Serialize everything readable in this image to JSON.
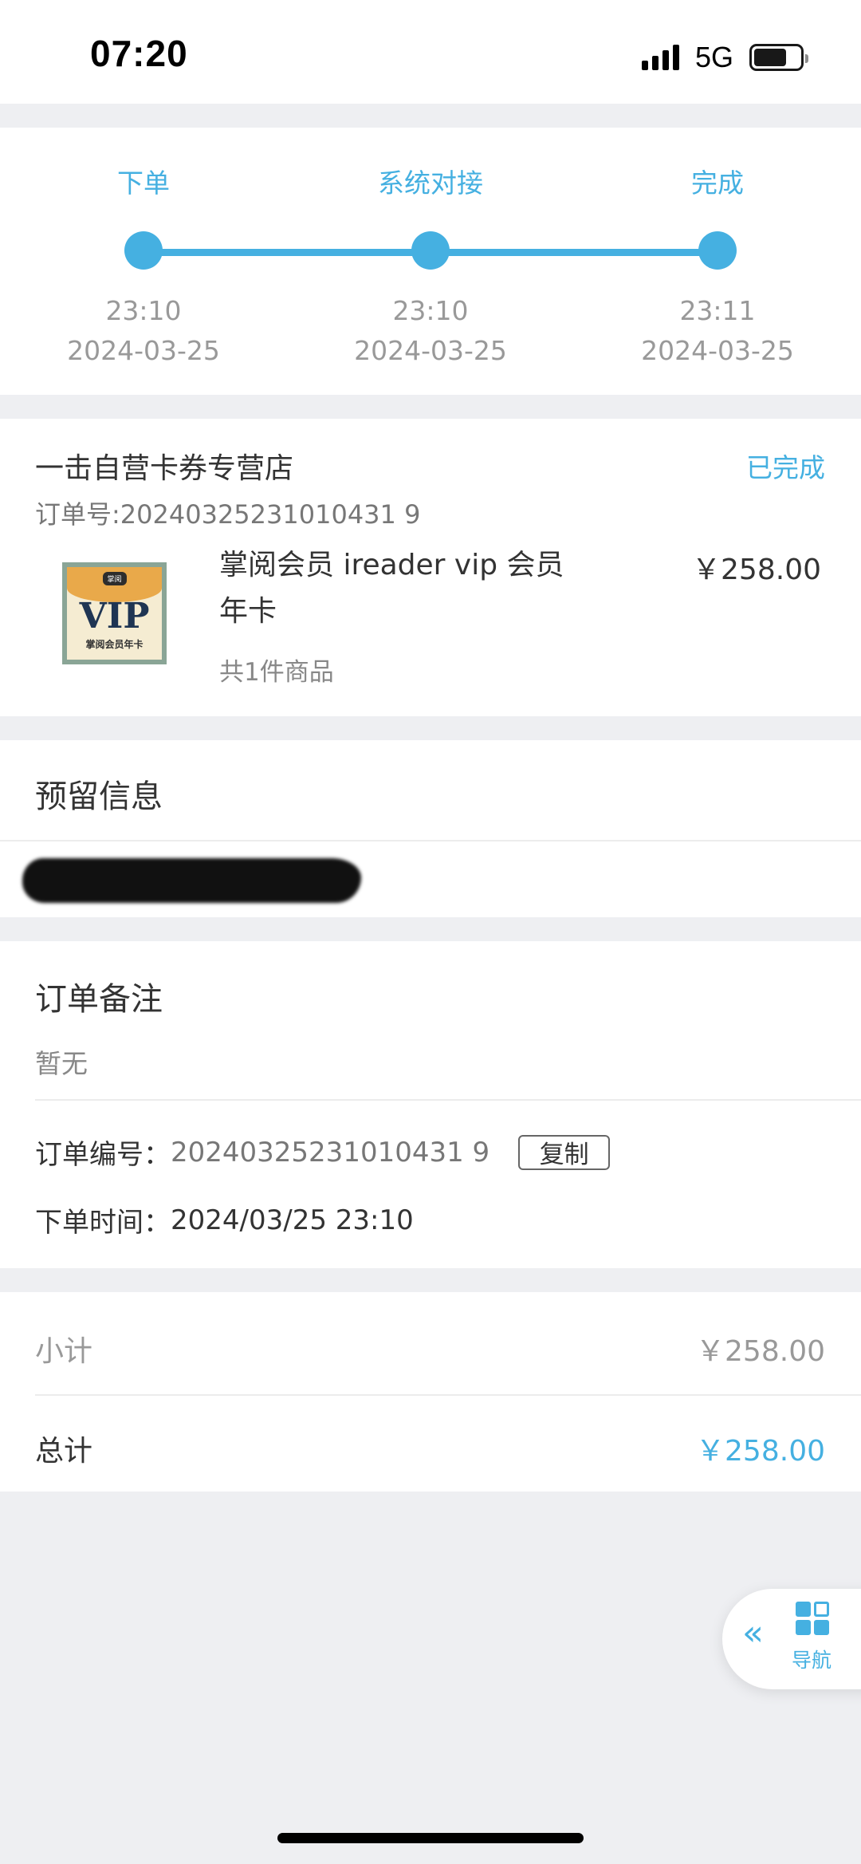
{
  "status_bar": {
    "time": "07:20",
    "network": "5G",
    "signal_bars": 4,
    "battery_level": 0.72
  },
  "colors": {
    "accent": "#45b0e1",
    "background": "#eeeff2"
  },
  "progress": {
    "steps": [
      {
        "title": "下单",
        "time": "23:10",
        "date": "2024-03-25"
      },
      {
        "title": "系统对接",
        "time": "23:10",
        "date": "2024-03-25"
      },
      {
        "title": "完成",
        "time": "23:11",
        "date": "2024-03-25"
      }
    ]
  },
  "store": {
    "name": "一击自营卡券专营店",
    "status": "已完成",
    "order_no_line": "订单号:20240325231010431 9"
  },
  "product": {
    "name": "掌阅会员 ireader vip 会员年卡",
    "price": "￥258.00",
    "count": "共1件商品",
    "thumb_brand": "掌阅",
    "thumb_vip": "VIP",
    "thumb_sub": "掌阅会员年卡"
  },
  "reserve": {
    "title": "预留信息"
  },
  "remark": {
    "title": "订单备注",
    "empty_text": "暂无",
    "order_number_label": "订单编号：",
    "order_number_value": "20240325231010431 9",
    "copy_label": "复制",
    "order_time_label": "下单时间：",
    "order_time_value": "2024/03/25 23:10"
  },
  "totals": {
    "subtotal_label": "小计",
    "subtotal_value": "￥258.00",
    "total_label": "总计",
    "total_value": "￥258.00"
  },
  "float_nav": {
    "chevron_icon": "double-chevron-left-icon",
    "grid_icon": "grid-icon",
    "label": "导航"
  }
}
